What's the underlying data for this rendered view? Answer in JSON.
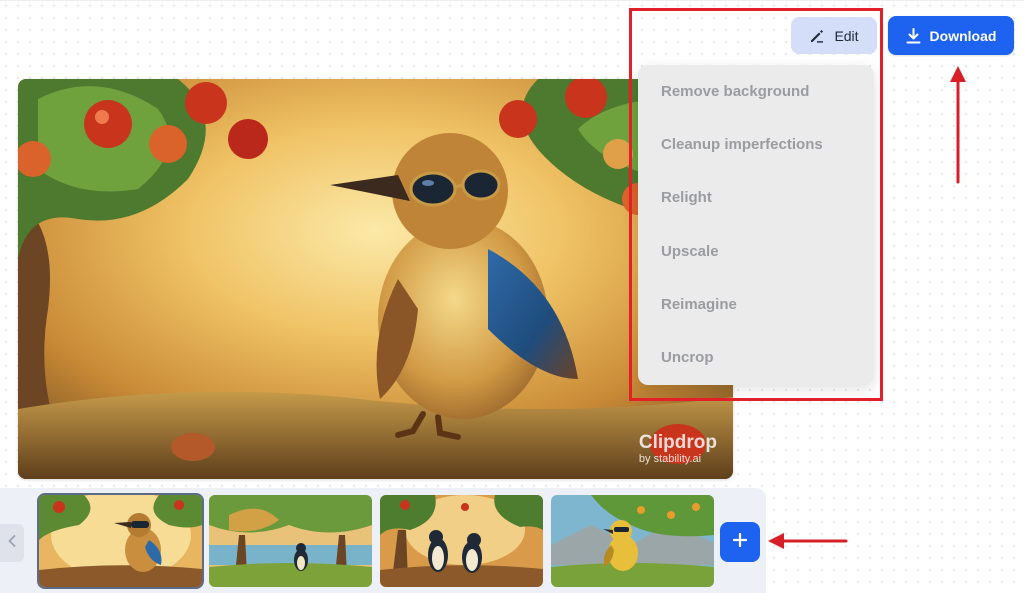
{
  "toolbar": {
    "edit_label": "Edit",
    "download_label": "Download"
  },
  "edit_menu": {
    "items": [
      {
        "label": "Remove background"
      },
      {
        "label": "Cleanup imperfections"
      },
      {
        "label": "Relight"
      },
      {
        "label": "Upscale"
      },
      {
        "label": "Reimagine"
      },
      {
        "label": "Uncrop"
      }
    ]
  },
  "watermark": {
    "title": "Clipdrop",
    "subtitle": "by stability.ai"
  },
  "thumbnails": {
    "count": 4,
    "selected_index": 0
  },
  "icons": {
    "edit": "pencil-icon",
    "download": "download-icon",
    "prev": "chevron-left-icon",
    "add": "plus-icon"
  },
  "colors": {
    "accent": "#1e63f0",
    "edit_button_bg": "#d5def8",
    "menu_bg": "#ebebeb",
    "menu_text": "#9a9ca1",
    "annotation_red": "#e3202a"
  }
}
